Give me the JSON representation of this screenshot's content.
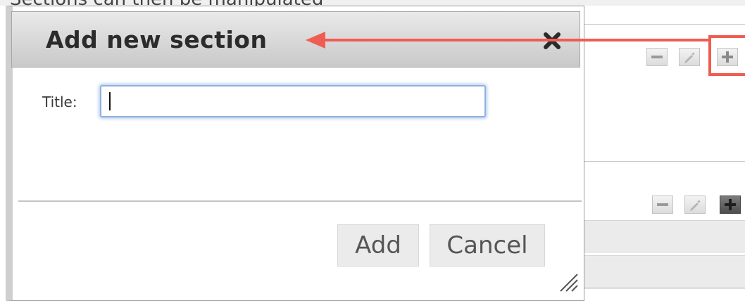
{
  "background": {
    "cut_heading": "Sections can then be manipulated"
  },
  "dialog": {
    "title": "Add new section",
    "title_label": "Title:",
    "title_input_value": "",
    "add_label": "Add",
    "cancel_label": "Cancel"
  },
  "icons": {
    "close": "close-icon",
    "minus": "minus-icon",
    "pencil": "pencil-icon",
    "plus": "plus-icon",
    "resize": "resize-grip-icon"
  },
  "colors": {
    "annotation": "#ef5d52",
    "input_focus": "#8fb2de"
  }
}
